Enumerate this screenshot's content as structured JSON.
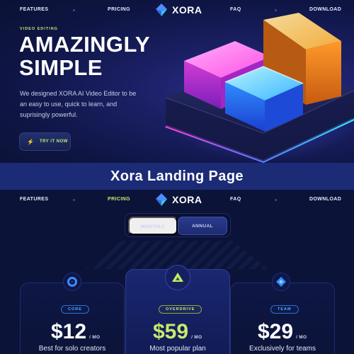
{
  "hero": {
    "nav": {
      "features": "FEATURES",
      "pricing": "PRICING",
      "faq": "FAQ",
      "download": "DOWNLOAD",
      "logo_text": "XORA"
    },
    "eyebrow": "VIDEO EDITING",
    "headline_line1": "AMAZINGLY",
    "headline_line2": "SIMPLE",
    "body_line1": "We designed XORA AI Video Editor to be",
    "body_line2": "an easy to use, quick to learn, and",
    "body_line3": "suprisingly powerful.",
    "cta_label": "TRY IT NOW"
  },
  "banner": {
    "title": "Xora Landing Page"
  },
  "pricing": {
    "nav": {
      "features": "FEATURES",
      "pricing": "PRICING",
      "faq": "FAQ",
      "download": "DOWNLOAD",
      "logo_text": "XORA"
    },
    "toggle": {
      "monthly": "MONTHLY",
      "annual": "ANNUAL",
      "selected": "ANNUAL"
    },
    "plans": [
      {
        "badge": "CORE",
        "price": "$12",
        "per": "/ MO",
        "desc": "Best for solo creators"
      },
      {
        "badge": "OVERDRIVE",
        "price": "$59",
        "per": "/ MO",
        "desc": "Most popular plan"
      },
      {
        "badge": "TEAM",
        "price": "$29",
        "per": "/ MO",
        "desc": "Exclusively for teams"
      }
    ]
  },
  "colors": {
    "accent_lime": "#c8ea6a",
    "accent_blue": "#2f6fd0",
    "background": "#0b1338",
    "banner": "#1c2b76"
  },
  "icons": {
    "logo": "xora-diamond-logo-icon",
    "cta": "lightning-bolt-icon",
    "core": "core-ring-icon",
    "overdrive": "overdrive-triangle-icon",
    "team": "team-diamond-icon"
  }
}
